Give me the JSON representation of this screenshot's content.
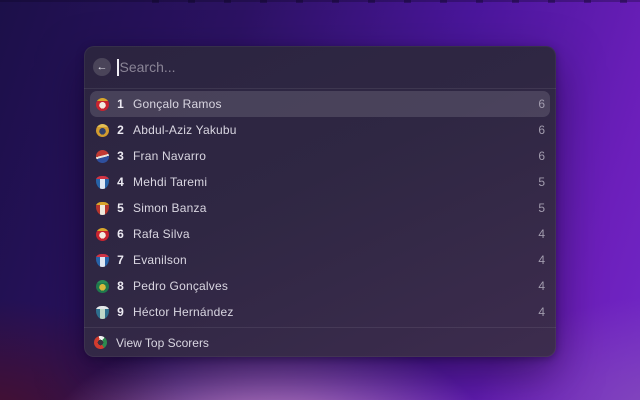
{
  "search": {
    "placeholder": "Search...",
    "value": "",
    "back_glyph": "←"
  },
  "list": {
    "rows": [
      {
        "rank": "1",
        "name": "Gonçalo Ramos",
        "value": "6",
        "selected": true,
        "badge": {
          "shape": "round",
          "type": "ring",
          "outer": "#c8242f",
          "inner": "#f2ece0",
          "cap": "#d9a62b"
        }
      },
      {
        "rank": "2",
        "name": "Abdul-Aziz Yakubu",
        "value": "6",
        "selected": false,
        "badge": {
          "shape": "round",
          "type": "ring",
          "outer": "#d29c2f",
          "inner": "#33416b",
          "cap": "#e2bf56"
        }
      },
      {
        "rank": "3",
        "name": "Fran Navarro",
        "value": "6",
        "selected": false,
        "badge": {
          "shape": "round",
          "type": "split",
          "top": "#c03a33",
          "mid": "#e9e5db",
          "bottom": "#2e4f9e"
        }
      },
      {
        "rank": "4",
        "name": "Mehdi Taremi",
        "value": "5",
        "selected": false,
        "badge": {
          "shape": "shield",
          "type": "shield",
          "body": "#2763a8",
          "stripe": "#dfe7f2",
          "cap": "#cf3444"
        }
      },
      {
        "rank": "5",
        "name": "Simon Banza",
        "value": "5",
        "selected": false,
        "badge": {
          "shape": "shield",
          "type": "shield",
          "body": "#b6352d",
          "stripe": "#efe9dc",
          "cap": "#d9a62b"
        }
      },
      {
        "rank": "6",
        "name": "Rafa Silva",
        "value": "4",
        "selected": false,
        "badge": {
          "shape": "round",
          "type": "ring",
          "outer": "#c8242f",
          "inner": "#f2ece0",
          "cap": "#d9a62b"
        }
      },
      {
        "rank": "7",
        "name": "Evanilson",
        "value": "4",
        "selected": false,
        "badge": {
          "shape": "shield",
          "type": "shield",
          "body": "#2763a8",
          "stripe": "#dfe7f2",
          "cap": "#cf3444"
        }
      },
      {
        "rank": "8",
        "name": "Pedro Gonçalves",
        "value": "4",
        "selected": false,
        "badge": {
          "shape": "round",
          "type": "ring",
          "outer": "#1f7a4d",
          "inner": "#d8b93c",
          "cap": "#2a8a57"
        }
      },
      {
        "rank": "9",
        "name": "Héctor Hernández",
        "value": "4",
        "selected": false,
        "badge": {
          "shape": "shield",
          "type": "shield",
          "body": "#2e6f8e",
          "stripe": "#bfd8c9",
          "cap": "#e4e8ea"
        }
      }
    ]
  },
  "footer": {
    "label": "View Top Scorers",
    "icon_colors": {
      "red": "#d23b2e",
      "green": "#2d8a4e",
      "white": "#f2f2f2",
      "center": "#3a3340"
    }
  },
  "colors": {
    "window_bg_top": "#2b2440",
    "window_bg_bottom": "#3d2c4e",
    "selection": "rgba(255,255,255,0.13)",
    "accent_purple": "#6c1fbb",
    "wallpaper_pink": "#dc9bd4"
  }
}
